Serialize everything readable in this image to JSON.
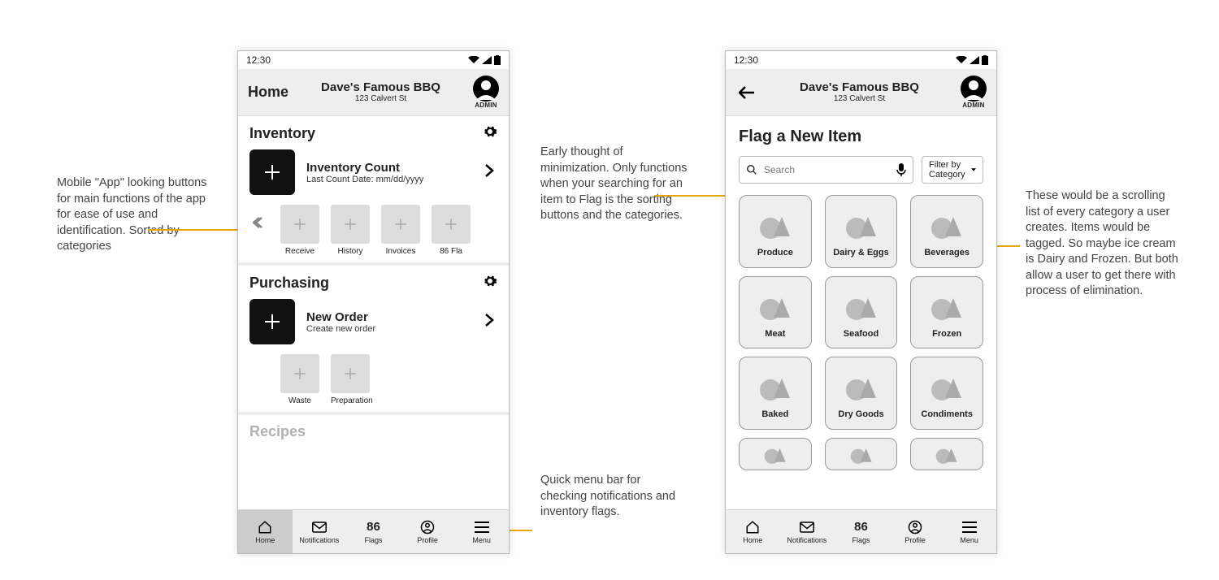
{
  "status_time": "12:30",
  "business": {
    "name": "Dave's Famous BBQ",
    "address": "123 Calvert St"
  },
  "admin_label": "ADMIN",
  "screen1": {
    "header_title": "Home",
    "inventory": {
      "title": "Inventory",
      "primary_title": "Inventory Count",
      "primary_sub": "Last Count Date: mm/dd/yyyy",
      "thumbs": [
        "Receive",
        "History",
        "Invoices",
        "86 Fla"
      ]
    },
    "purchasing": {
      "title": "Purchasing",
      "primary_title": "New Order",
      "primary_sub": "Create new order",
      "thumbs": [
        "Waste",
        "Preparation"
      ]
    },
    "recipes_title": "Recipes"
  },
  "screen2": {
    "page_title": "Flag a New Item",
    "search_placeholder": "Search",
    "filter_label": "Filter by Category",
    "categories": [
      "Produce",
      "Dairy & Eggs",
      "Beverages",
      "Meat",
      "Seafood",
      "Frozen",
      "Baked",
      "Dry Goods",
      "Condiments"
    ]
  },
  "bottom_bar": {
    "items": [
      {
        "label": "Home"
      },
      {
        "label": "Notifications"
      },
      {
        "count": "86",
        "label": "Flags"
      },
      {
        "label": "Profile"
      },
      {
        "label": "Menu"
      }
    ]
  },
  "annotations": {
    "a1": "Mobile \"App\" looking buttons for main functions of the app for ease of use and identification. Sorted by categories",
    "a2": "Early thought of minimization. Only functions when your searching for an item to Flag is the sorting buttons and the categories.",
    "a3": "Quick menu bar for checking notifications and inventory flags.",
    "a4": "These would be a scrolling list of every category a user creates. Items would be tagged. So maybe ice cream is Dairy and Frozen. But both allow a user to get there with process of elimination."
  }
}
